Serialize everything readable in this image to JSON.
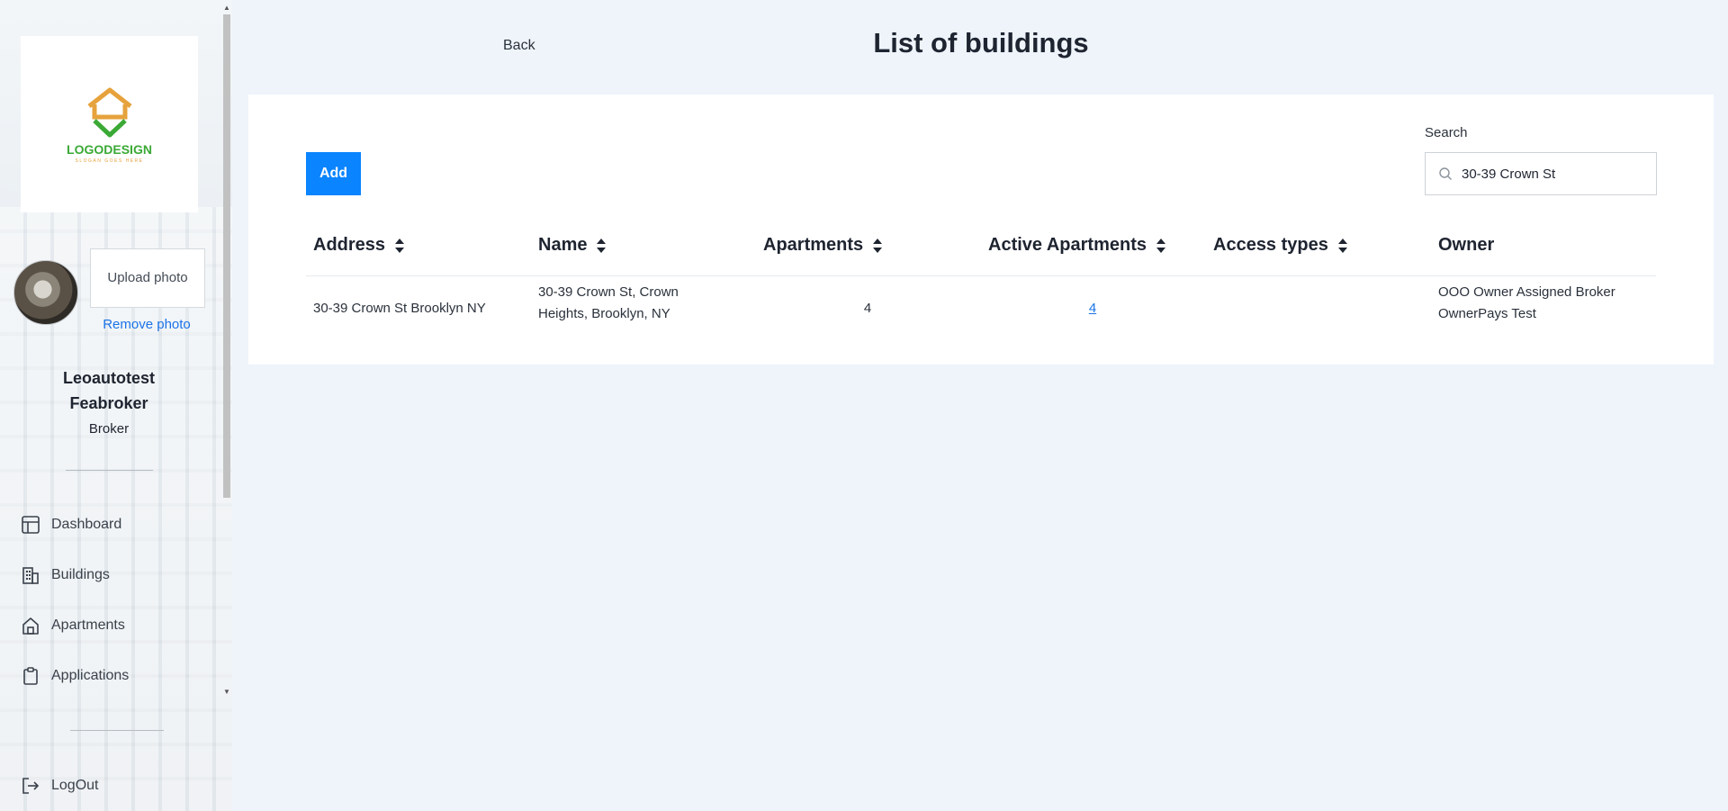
{
  "sidebar": {
    "logo": {
      "text": "LOGODESIGN",
      "subtext": "SLOGAN GOES HERE",
      "brand_green": "#3aa935",
      "brand_orange": "#e6a23c"
    },
    "upload_photo_label": "Upload photo",
    "remove_photo_label": "Remove photo",
    "user": {
      "first_name": "Leoautotest",
      "last_name": "Feabroker",
      "role": "Broker"
    },
    "items": [
      {
        "label": "Dashboard",
        "icon": "dashboard-icon"
      },
      {
        "label": "Buildings",
        "icon": "buildings-icon"
      },
      {
        "label": "Apartments",
        "icon": "home-icon"
      },
      {
        "label": "Applications",
        "icon": "clipboard-icon"
      }
    ],
    "logout_label": "LogOut"
  },
  "header": {
    "back_label": "Back",
    "title": "List of buildings"
  },
  "toolbar": {
    "add_label": "Add",
    "search_label": "Search",
    "search_value": "30-39 Crown St"
  },
  "table": {
    "columns": [
      "Address",
      "Name",
      "Apartments",
      "Active Apartments",
      "Access types",
      "Owner"
    ],
    "rows": [
      {
        "address": "30-39 Crown St Brooklyn NY",
        "name": "30-39 Crown St, Crown Heights, Brooklyn, NY",
        "apartments": "4",
        "active_apartments": "4",
        "access_types": "",
        "owner": "OOO Owner Assigned Broker OwnerPays Test"
      }
    ]
  },
  "colors": {
    "accent": "#0a84ff",
    "link": "#1a73e8",
    "background": "#eef4fa"
  }
}
